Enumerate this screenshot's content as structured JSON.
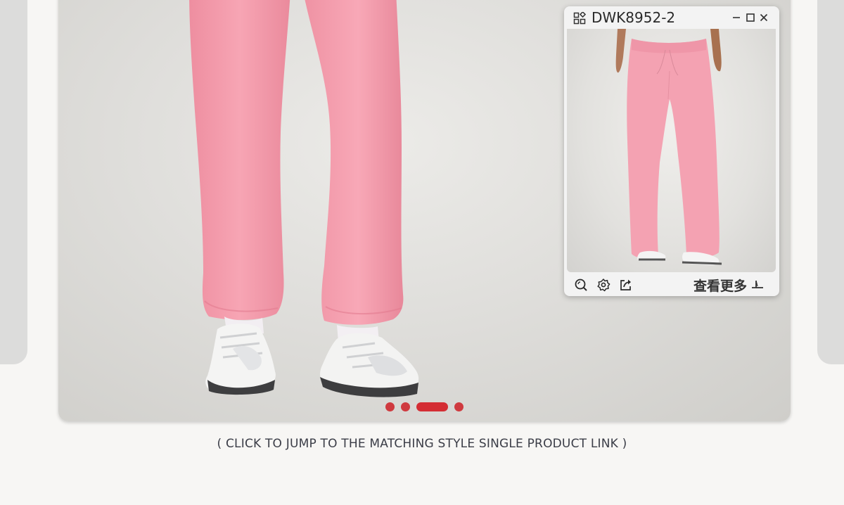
{
  "carousel": {
    "slide_count": 4,
    "active_index": 2,
    "colors": {
      "dot": "#cf3a3f",
      "active_dot": "#d42d33",
      "pants": "#f49cad"
    }
  },
  "caption": "( CLICK TO JUMP TO THE MATCHING STYLE SINGLE PRODUCT LINK )",
  "floating_window": {
    "title": "DWK8952-2",
    "title_icon": "apps-grid-icon",
    "controls": [
      "minimize-icon",
      "maximize-icon",
      "close-icon"
    ],
    "toolbar": [
      "zoom-icon",
      "gear-icon",
      "share-icon"
    ],
    "more_label": "查看更多",
    "more_icon": "arrow-corner-icon"
  }
}
